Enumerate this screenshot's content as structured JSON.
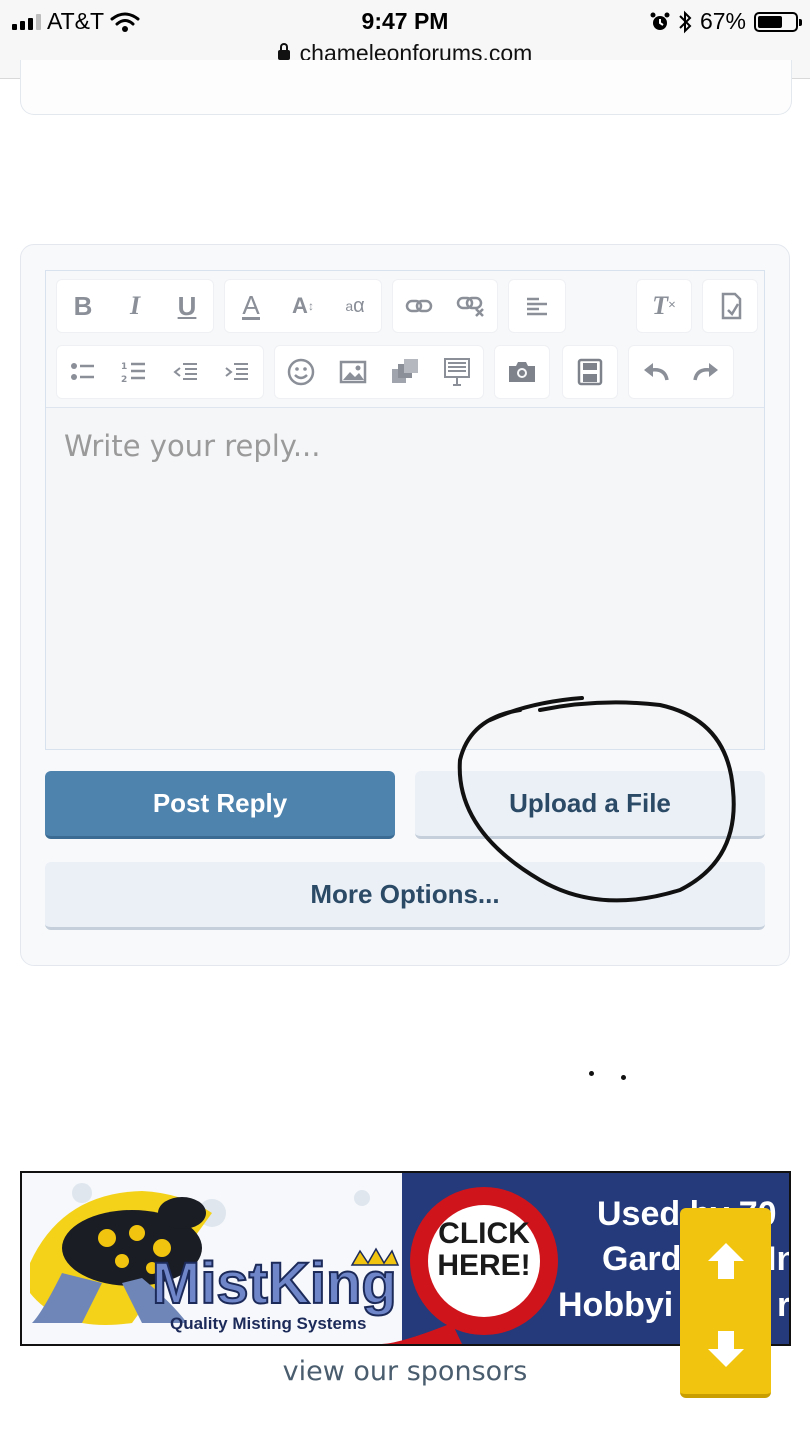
{
  "status_bar": {
    "carrier": "AT&T",
    "time": "9:47 PM",
    "battery": "67%",
    "battery_level": 0.67,
    "url": "chameleonforums.com"
  },
  "editor": {
    "toolbar_row1": [
      "bold-icon",
      "italic-icon",
      "underline-icon",
      "text-color-icon",
      "font-size-icon",
      "font-family-icon",
      "link-icon",
      "unlink-icon",
      "align-icon",
      "clear-format-icon",
      "toggle-bbcode-icon"
    ],
    "toolbar_row2": [
      "bullet-list-icon",
      "numbered-list-icon",
      "outdent-icon",
      "indent-icon",
      "smiley-icon",
      "image-icon",
      "media-icon",
      "insert-icon",
      "camera-icon",
      "save-draft-icon",
      "undo-icon",
      "redo-icon"
    ],
    "placeholder": "Write your reply..."
  },
  "buttons": {
    "post_reply": "Post Reply",
    "upload_file": "Upload a File",
    "more_options": "More Options..."
  },
  "banner": {
    "brand": "MistKing",
    "tagline": "Quality Misting Systems",
    "cta_line1": "CLICK",
    "cta_line2": "HERE!",
    "text_line1": "Used by 70",
    "text_line2": "Gard",
    "text_line2_end": "In",
    "text_line3": "Hobbyi",
    "text_line3_end": "r"
  },
  "sponsors_link": "view our sponsors",
  "colors": {
    "primary": "#4e83ae",
    "secondary_bg": "#ebf0f7",
    "secondary_text": "#2b4a66",
    "scroll_widget": "#f1c40f",
    "banner_navy": "#243a7a"
  }
}
